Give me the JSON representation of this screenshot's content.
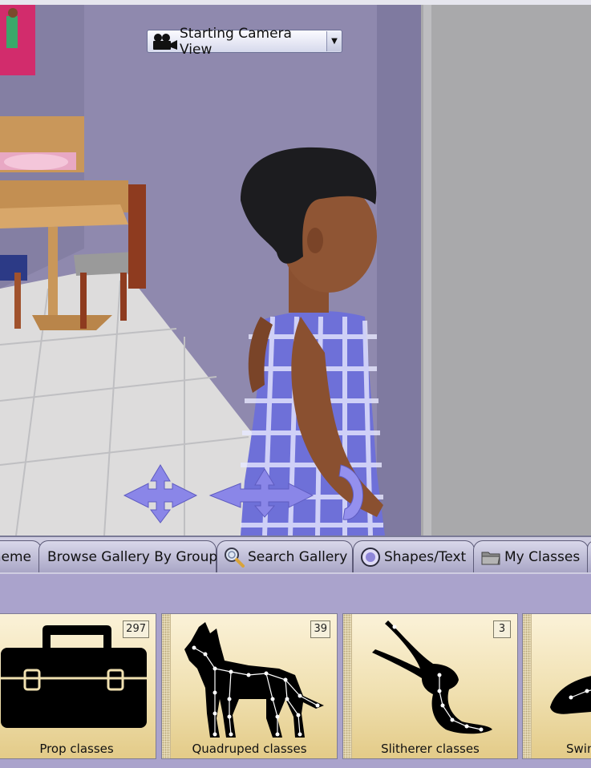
{
  "viewport": {
    "camera_view": {
      "label": "Starting Camera View",
      "icon": "movie-camera-icon"
    },
    "manipulators": [
      "move-arrows-icon",
      "rotate-arrows-icon",
      "turn-ring-icon"
    ]
  },
  "tabs": [
    {
      "label": "heme",
      "icon": null
    },
    {
      "label": "Browse Gallery By Group",
      "icon": null
    },
    {
      "label": "Search Gallery",
      "icon": "magnifier-icon"
    },
    {
      "label": "Shapes/Text",
      "icon": "circle-shape-icon"
    },
    {
      "label": "My Classes",
      "icon": "folder-icon"
    }
  ],
  "gallery": {
    "cards": [
      {
        "label": "Prop classes",
        "count": "297",
        "icon": "toolbox-icon"
      },
      {
        "label": "Quadruped classes",
        "count": "39",
        "icon": "quadruped-skeleton-icon"
      },
      {
        "label": "Slitherer classes",
        "count": "3",
        "icon": "slitherer-skeleton-icon"
      },
      {
        "label": "Swin",
        "count": "",
        "icon": "swimmer-skeleton-icon"
      }
    ]
  },
  "colors": {
    "accent": "#8a80d8",
    "tab_bar_bg": "#cfcde1",
    "gallery_bg": "#aaa3cc",
    "card_bg": "#f0e0b0"
  }
}
